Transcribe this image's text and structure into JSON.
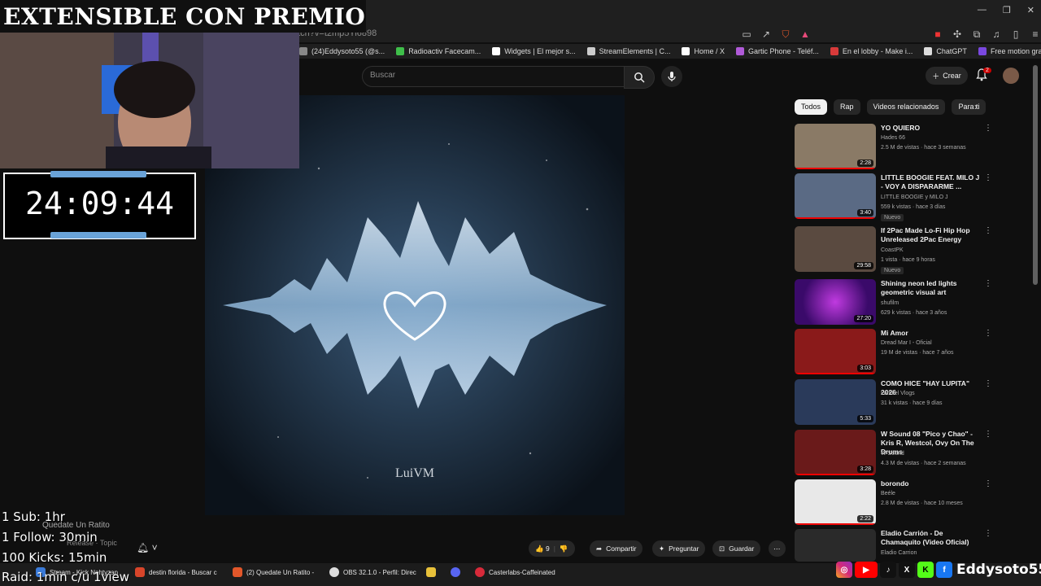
{
  "overlay": {
    "title": "EXTENSIBLE CON PREMIO",
    "timer": "24:09:44",
    "rules": [
      "1 Sub: 1hr",
      "1 Follow: 30min",
      "100 Kicks: 15min",
      "Raid: 1min c/u 1view"
    ],
    "socials_handle": "Eddysoto55"
  },
  "browser": {
    "url_fragment": "atch?v=t2mp5Yi6898",
    "bookmarks": [
      {
        "label": "(24)Eddysoto55 (@s...",
        "color": "#888888"
      },
      {
        "label": "Radioactiv Facecam...",
        "color": "#3fbf4a"
      },
      {
        "label": "Widgets | El mejor s...",
        "color": "#ffffff"
      },
      {
        "label": "StreamElements | C...",
        "color": "#cccccc"
      },
      {
        "label": "Home / X",
        "color": "#ffffff"
      },
      {
        "label": "Gartic Phone - Teléf...",
        "color": "#b05ad8"
      },
      {
        "label": "En el lobby - Make i...",
        "color": "#d83a3a"
      },
      {
        "label": "ChatGPT",
        "color": "#dddddd"
      },
      {
        "label": "Free motion graphic...",
        "color": "#7a48e0"
      }
    ]
  },
  "header": {
    "search_placeholder": "Buscar",
    "create_label": "Crear",
    "notifications": "2"
  },
  "video": {
    "artist_text": "LuiVM"
  },
  "chips": [
    "Todos",
    "Rap",
    "Videos relacionados",
    "Para ti"
  ],
  "recommendations": [
    {
      "title": "YO QUIERO",
      "channel": "Hades 66",
      "meta": "2.5 M de vistas · hace 3 semanas",
      "duration": "2:28",
      "badge": "",
      "thumb": "#8a7a66",
      "progress": 100
    },
    {
      "title": "LITTLE BOOGIE FEAT. MILO J - VOY A DISPARARME ...",
      "channel": "LITTLE BOOGIE y MILO J",
      "meta": "559 k vistas · hace 3 días",
      "duration": "3:40",
      "badge": "Nuevo",
      "thumb": "#5a6a84",
      "progress": 100
    },
    {
      "title": "If 2Pac Made Lo-Fi Hip Hop Unreleased 2Pac Energy",
      "channel": "CoastPK",
      "meta": "1 vista · hace 9 horas",
      "duration": "29:58",
      "badge": "Nuevo",
      "thumb": "#5a4a40",
      "progress": 0
    },
    {
      "title": "Shining neon led lights geometric visual art",
      "channel": "shufilm",
      "meta": "629 k vistas · hace 3 años",
      "duration": "27:20",
      "badge": "",
      "thumb": "#4a1a7a",
      "progress": 0
    },
    {
      "title": "Mi Amor",
      "channel": "Dread Mar I - Oficial",
      "meta": "19 M de vistas · hace 7 años",
      "duration": "3:03",
      "badge": "",
      "thumb": "#8a1a1a",
      "progress": 100
    },
    {
      "title": "COMO HICE \"HAY LUPITA\" 2026",
      "channel": "Lomiiel Vlogs",
      "meta": "31 k vistas · hace 9 días",
      "duration": "5:33",
      "badge": "",
      "thumb": "#2a3a5a",
      "progress": 0
    },
    {
      "title": "W Sound 08 \"Pico y Chao\" - Kris R, Westcol, Ovy On The Drums",
      "channel": "W Sound",
      "meta": "4.3 M de vistas · hace 2 semanas",
      "duration": "3:28",
      "badge": "",
      "thumb": "#6a1a1a",
      "progress": 100
    },
    {
      "title": "borondo",
      "channel": "Beéle",
      "meta": "2.8 M de vistas · hace 10 meses",
      "duration": "2:22",
      "badge": "",
      "thumb": "#e8e8e8",
      "progress": 100
    },
    {
      "title": "Eladio Carrión - De Chamaquito (Video Oficial)",
      "channel": "Eladio Carrion",
      "meta": "",
      "duration": "",
      "badge": "",
      "thumb": "#2a2a2a",
      "progress": 0
    }
  ],
  "actions": {
    "likes": "9",
    "share": "Compartir",
    "ask": "Preguntar",
    "save": "Guardar"
  },
  "background_text": {
    "song": "Quedate Un Ratito",
    "artist": "Release · Topic"
  },
  "taskbar": [
    {
      "label": "Stream - Kick Nahtyzan",
      "color": "#3a7ad8"
    },
    {
      "label": "destin florida - Buscar c",
      "color": "#d8452a"
    },
    {
      "label": "(2) Quedate Un Ratito -",
      "color": "#e2572a"
    },
    {
      "label": "OBS 32.1.0 - Perfil: Direc",
      "color": "#dddddd"
    },
    {
      "label": "",
      "color": "#e8c13a"
    },
    {
      "label": "",
      "color": "#5865f2"
    },
    {
      "label": "Casterlabs-Caffeinated",
      "color": "#d82a3a"
    }
  ],
  "colors": {
    "accent": "#ff0000",
    "timer_bars": "#6aa3d8"
  }
}
